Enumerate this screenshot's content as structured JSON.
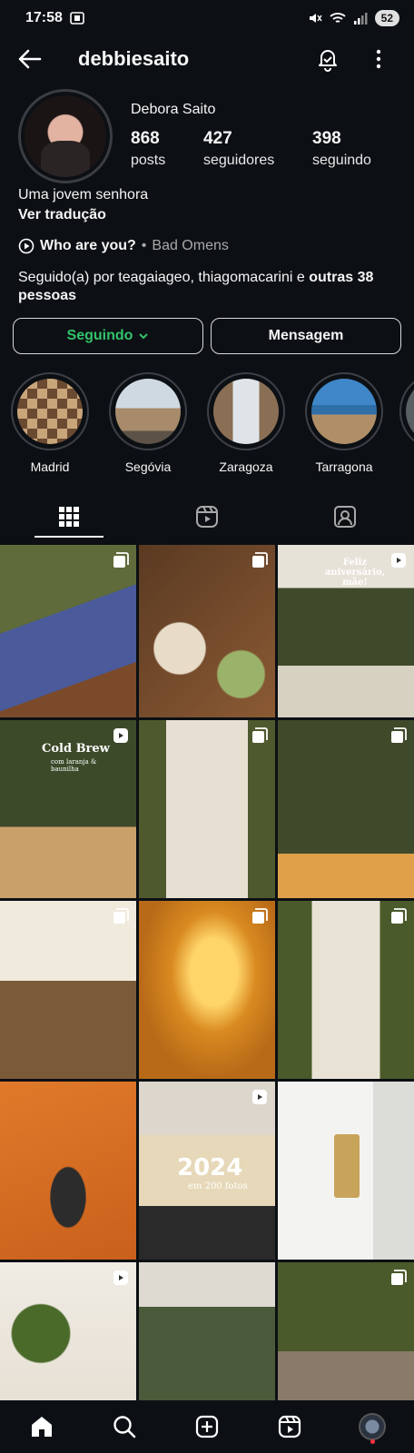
{
  "status_bar": {
    "time": "17:58",
    "battery": "52"
  },
  "header": {
    "username": "debbiesaito"
  },
  "profile": {
    "full_name": "Debora Saito",
    "stats": [
      {
        "value": "868",
        "label": "posts"
      },
      {
        "value": "427",
        "label": "seguidores"
      },
      {
        "value": "398",
        "label": "seguindo"
      }
    ],
    "bio": "Uma jovem senhora",
    "translate_label": "Ver tradução",
    "music": {
      "song": "Who are you?",
      "separator": "•",
      "artist": "Bad Omens"
    },
    "followed_by": {
      "prefix": "Seguido(a) por teagaiageo, thiagomacarini e ",
      "bold": "outras 38 pessoas"
    }
  },
  "actions": {
    "following_label": "Seguindo",
    "message_label": "Mensagem"
  },
  "highlights": [
    {
      "label": "Madrid"
    },
    {
      "label": "Segóvia"
    },
    {
      "label": "Zaragoza"
    },
    {
      "label": "Tarragona"
    }
  ],
  "posts": {
    "overlays": {
      "birthday": "Feliz aniversário, mãe!",
      "cold_brew_title": "Cold Brew",
      "cold_brew_sub": "com laranja & baunilha",
      "year": "2024",
      "year_sub": "em 200 fotos"
    }
  },
  "colors": {
    "accent_following": "#33c26a",
    "background": "#0c1014"
  }
}
